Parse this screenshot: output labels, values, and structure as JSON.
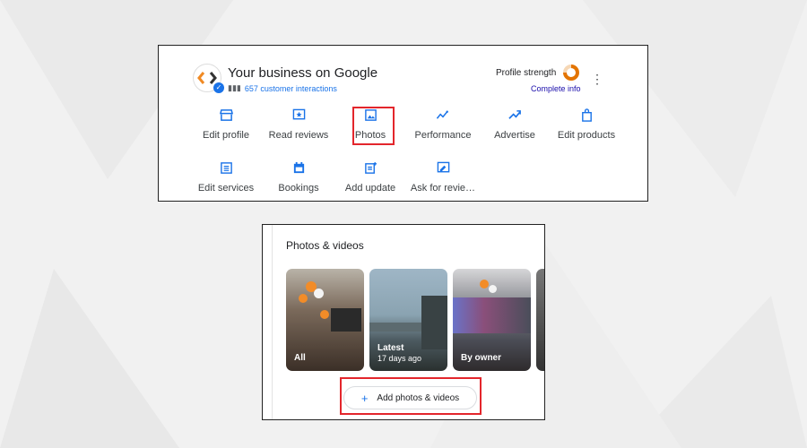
{
  "header": {
    "title": "Your business on Google",
    "interactions": "657 customer interactions",
    "profile_strength_label": "Profile strength",
    "complete_info": "Complete info"
  },
  "actions": [
    {
      "label": "Edit profile",
      "icon": "storefront-icon"
    },
    {
      "label": "Read reviews",
      "icon": "reviews-icon"
    },
    {
      "label": "Photos",
      "icon": "image-icon"
    },
    {
      "label": "Performance",
      "icon": "trend-icon"
    },
    {
      "label": "Advertise",
      "icon": "advertise-icon"
    },
    {
      "label": "Edit products",
      "icon": "shopping-bag-icon"
    },
    {
      "label": "Edit services",
      "icon": "services-list-icon"
    },
    {
      "label": "Bookings",
      "icon": "calendar-icon"
    },
    {
      "label": "Add update",
      "icon": "post-add-icon"
    },
    {
      "label": "Ask for revie…",
      "icon": "review-request-icon"
    }
  ],
  "photos": {
    "title": "Photos & videos",
    "tiles": [
      {
        "label": "All",
        "sub": ""
      },
      {
        "label": "Latest",
        "sub": "17 days ago"
      },
      {
        "label": "By owner",
        "sub": ""
      }
    ],
    "add_button": "Add photos & videos"
  },
  "colors": {
    "accent": "#1a73e8",
    "highlight": "#e3262c",
    "strength_ring": "#e37400"
  }
}
